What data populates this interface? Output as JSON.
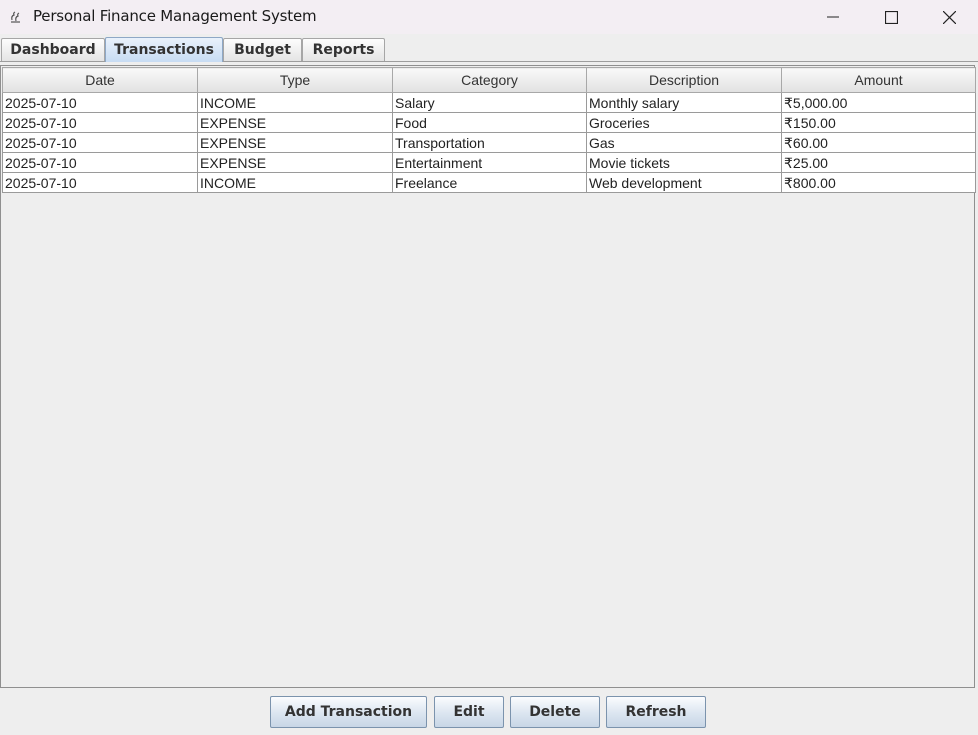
{
  "window": {
    "title": "Personal Finance Management System",
    "icons": {
      "app": "java-cup-icon",
      "minimize": "minimize-icon",
      "maximize": "maximize-icon",
      "close": "close-icon"
    }
  },
  "tabs": [
    {
      "label": "Dashboard",
      "active": false
    },
    {
      "label": "Transactions",
      "active": true
    },
    {
      "label": "Budget",
      "active": false
    },
    {
      "label": "Reports",
      "active": false
    }
  ],
  "table": {
    "columns": [
      "Date",
      "Type",
      "Category",
      "Description",
      "Amount"
    ],
    "rows": [
      [
        "2025-07-10",
        "INCOME",
        "Salary",
        "Monthly salary",
        "₹5,000.00"
      ],
      [
        "2025-07-10",
        "EXPENSE",
        "Food",
        "Groceries",
        "₹150.00"
      ],
      [
        "2025-07-10",
        "EXPENSE",
        "Transportation",
        "Gas",
        "₹60.00"
      ],
      [
        "2025-07-10",
        "EXPENSE",
        "Entertainment",
        "Movie tickets",
        "₹25.00"
      ],
      [
        "2025-07-10",
        "INCOME",
        "Freelance",
        "Web development",
        "₹800.00"
      ]
    ]
  },
  "buttons": {
    "add": "Add Transaction",
    "edit": "Edit",
    "delete": "Delete",
    "refresh": "Refresh"
  },
  "colors": {
    "active_tab": "#c7dcf3",
    "button": "#dbe5f0"
  }
}
